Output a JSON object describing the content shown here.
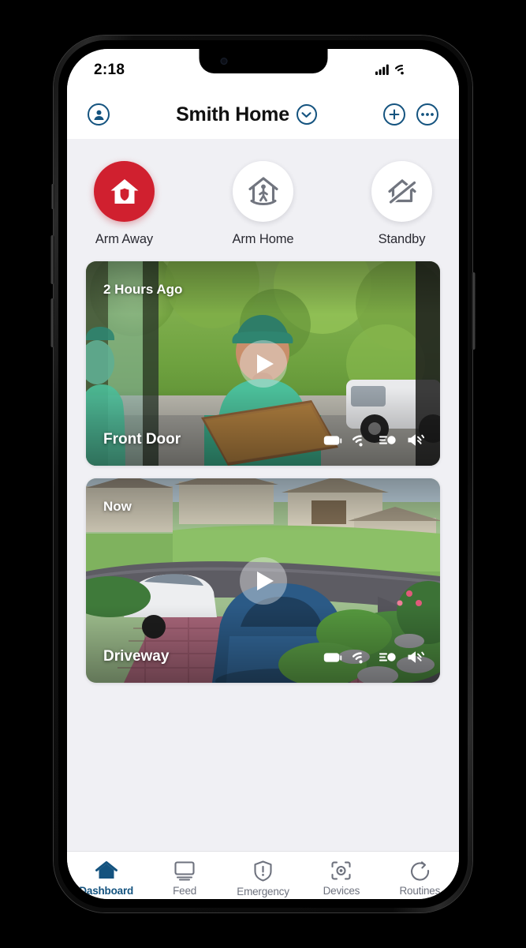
{
  "status_bar": {
    "time": "2:18",
    "icons": [
      "cellular-signal-icon",
      "wifi-icon",
      "battery-icon"
    ]
  },
  "header": {
    "profile_icon": "profile-icon",
    "title": "Smith Home",
    "dropdown_icon": "chevron-down-icon",
    "add_icon": "plus-icon",
    "more_icon": "more-options-icon"
  },
  "modes": [
    {
      "label": "Arm Away",
      "icon": "house-shield-icon",
      "active": true
    },
    {
      "label": "Arm Home",
      "icon": "house-person-icon",
      "active": false
    },
    {
      "label": "Standby",
      "icon": "house-slash-icon",
      "active": false
    }
  ],
  "cameras": [
    {
      "name": "Front Door",
      "time": "2 Hours Ago",
      "play_icon": "play-icon",
      "status_icons": [
        "battery-icon",
        "wifi-icon",
        "motion-sensor-icon",
        "speaker-icon"
      ]
    },
    {
      "name": "Driveway",
      "time": "Now",
      "play_icon": "play-icon",
      "status_icons": [
        "battery-icon",
        "wifi-icon",
        "motion-sensor-icon",
        "speaker-icon"
      ]
    }
  ],
  "tabs": [
    {
      "label": "Dashboard",
      "icon": "home-icon",
      "active": true
    },
    {
      "label": "Feed",
      "icon": "monitor-icon",
      "active": false
    },
    {
      "label": "Emergency",
      "icon": "shield-alert-icon",
      "active": false
    },
    {
      "label": "Devices",
      "icon": "device-scan-icon",
      "active": false
    },
    {
      "label": "Routines",
      "icon": "refresh-circle-icon",
      "active": false
    }
  ],
  "colors": {
    "accent": "#14537f",
    "armed": "#d0202f",
    "inactive": "#6e727e",
    "background": "#f0f0f4"
  }
}
